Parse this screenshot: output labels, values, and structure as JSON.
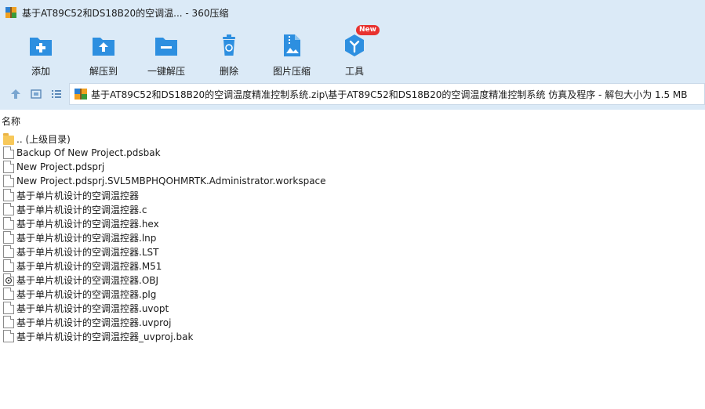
{
  "window": {
    "title": "基于AT89C52和DS18B20的空调温... - 360压缩"
  },
  "toolbar": {
    "add": "添加",
    "extract_to": "解压到",
    "one_click_extract": "一键解压",
    "delete": "删除",
    "image_compress": "图片压缩",
    "tools": "工具",
    "new_badge": "New"
  },
  "address": {
    "path": "基于AT89C52和DS18B20的空调温度精准控制系统.zip\\基于AT89C52和DS18B20的空调温度精准控制系统 仿真及程序 - 解包大小为 1.5 MB"
  },
  "columns": {
    "name": "名称"
  },
  "files": [
    {
      "name": ".. (上级目录)",
      "type": "folder"
    },
    {
      "name": "Backup Of New Project.pdsbak",
      "type": "doc"
    },
    {
      "name": "New Project.pdsprj",
      "type": "doc"
    },
    {
      "name": "New Project.pdsprj.SVL5MBPHQOHMRTK.Administrator.workspace",
      "type": "doc"
    },
    {
      "name": "基于单片机设计的空调温控器",
      "type": "doc"
    },
    {
      "name": "基于单片机设计的空调温控器.c",
      "type": "doc"
    },
    {
      "name": "基于单片机设计的空调温控器.hex",
      "type": "doc"
    },
    {
      "name": "基于单片机设计的空调温控器.lnp",
      "type": "doc"
    },
    {
      "name": "基于单片机设计的空调温控器.LST",
      "type": "doc"
    },
    {
      "name": "基于单片机设计的空调温控器.M51",
      "type": "doc"
    },
    {
      "name": "基于单片机设计的空调温控器.OBJ",
      "type": "obj"
    },
    {
      "name": "基于单片机设计的空调温控器.plg",
      "type": "doc"
    },
    {
      "name": "基于单片机设计的空调温控器.uvopt",
      "type": "doc"
    },
    {
      "name": "基于单片机设计的空调温控器.uvproj",
      "type": "doc"
    },
    {
      "name": "基于单片机设计的空调温控器_uvproj.bak",
      "type": "doc"
    }
  ],
  "colors": {
    "accent": "#2d8fe0",
    "chrome": "#dbeaf7",
    "badge": "#e8322f"
  }
}
